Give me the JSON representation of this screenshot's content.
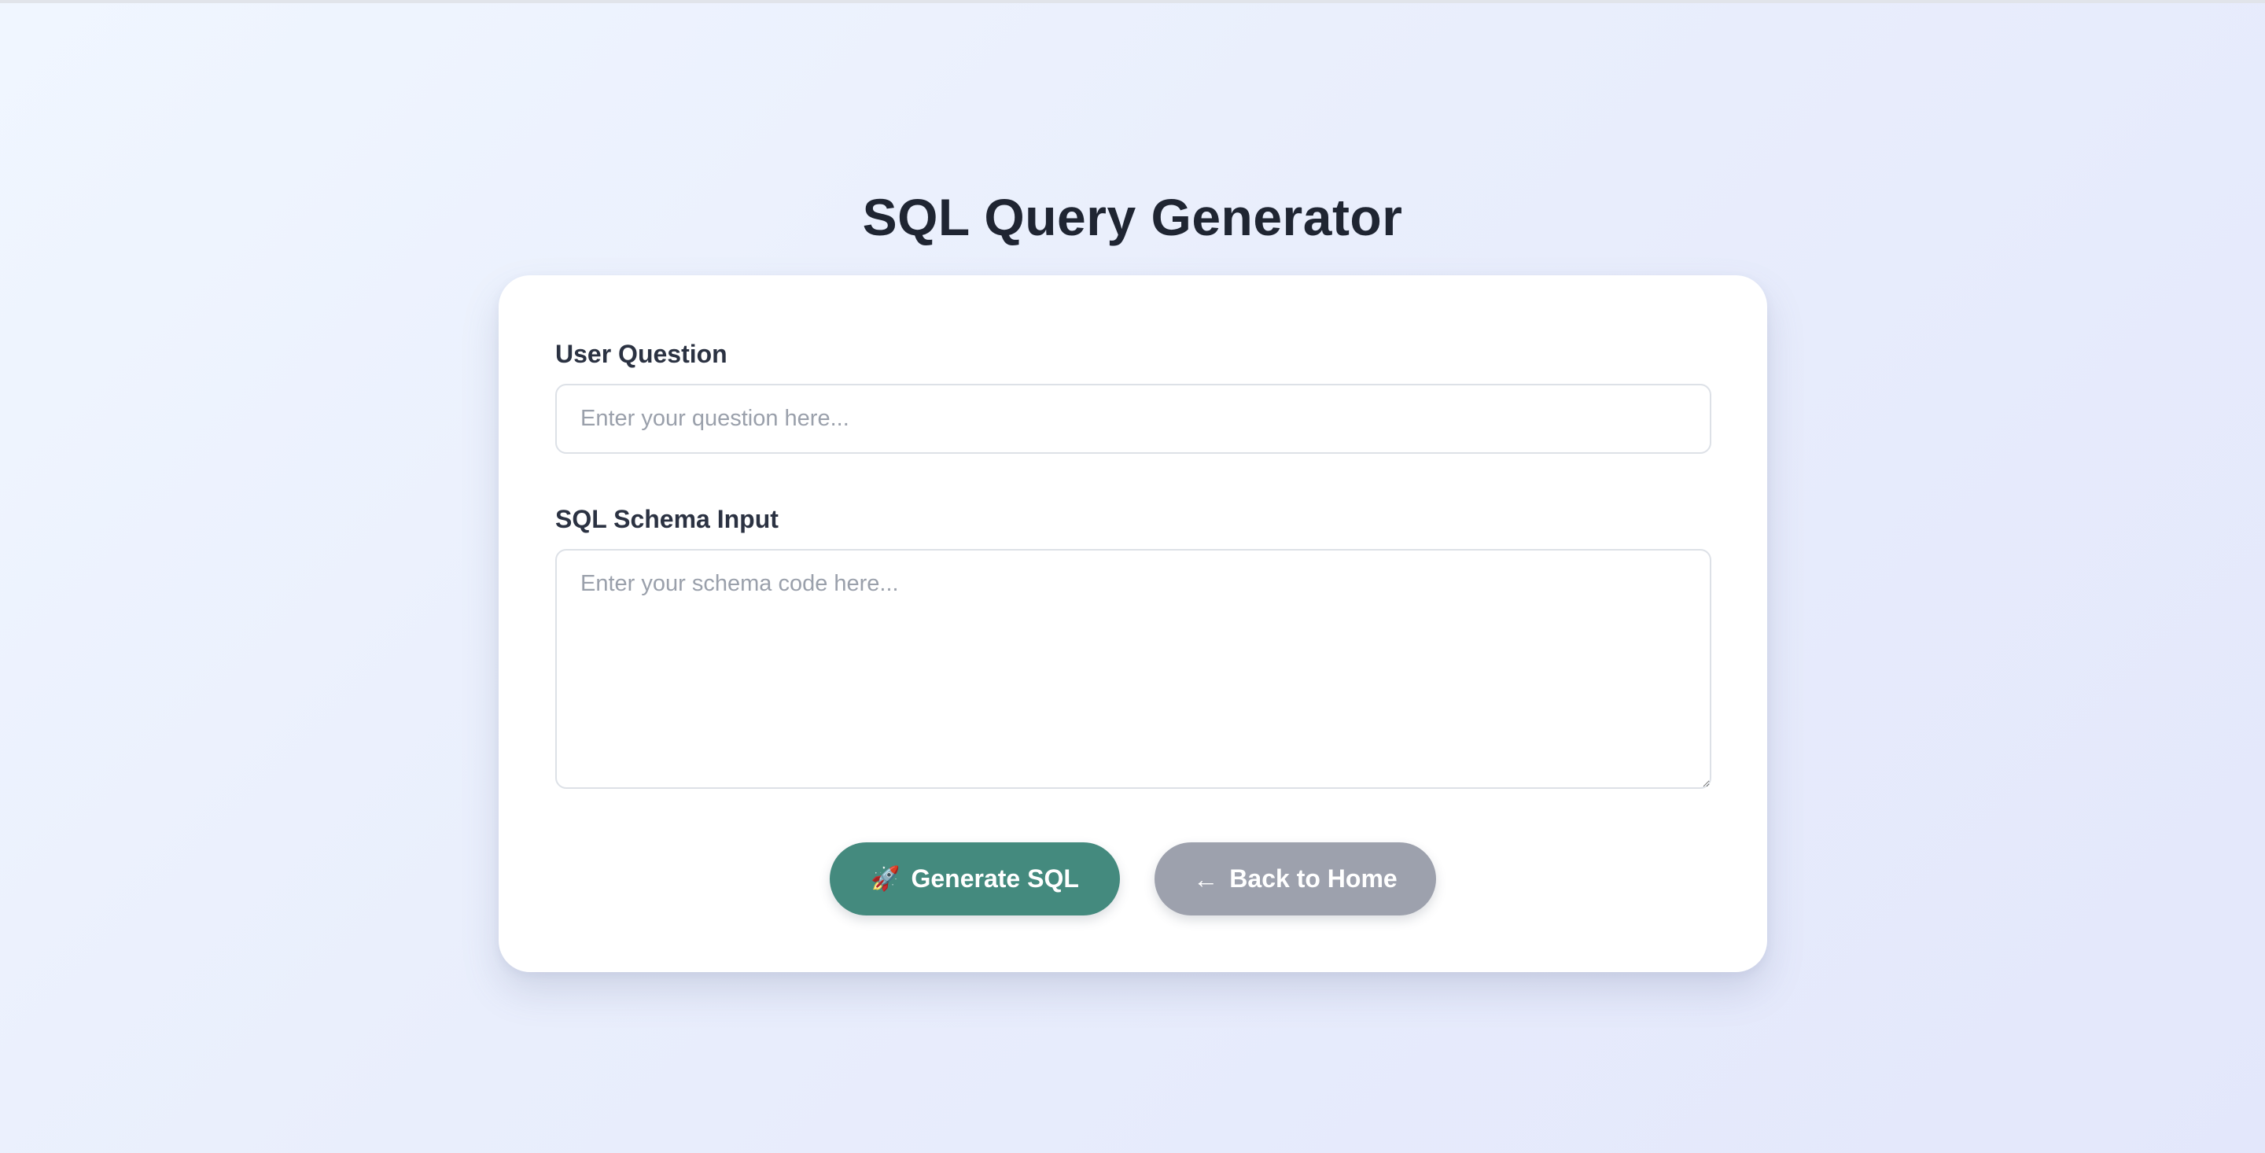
{
  "page": {
    "title": "SQL Query Generator",
    "accent_color": "#448a7e",
    "secondary_button_color": "#9da1ad"
  },
  "form": {
    "question": {
      "label": "User Question",
      "value": "",
      "placeholder": "Enter your question here..."
    },
    "schema": {
      "label": "SQL Schema Input",
      "value": "",
      "placeholder": "Enter your schema code here..."
    }
  },
  "actions": {
    "generate": {
      "icon": "rocket-icon",
      "icon_glyph": "🚀",
      "label": "Generate SQL"
    },
    "back": {
      "icon": "left-arrow-icon",
      "icon_glyph": "←",
      "label": "Back to Home"
    }
  }
}
